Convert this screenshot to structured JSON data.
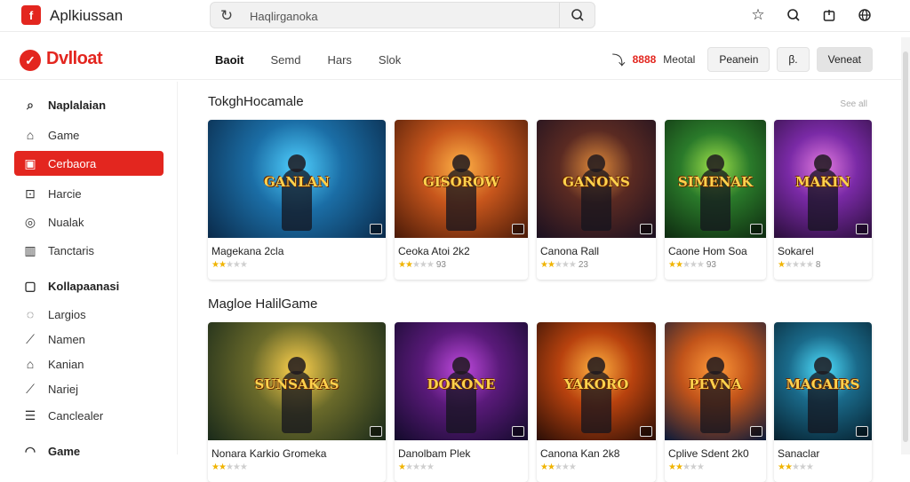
{
  "app": {
    "title": "Aplkiussan",
    "logo_glyph": "f"
  },
  "search": {
    "placeholder": "Haqlirganoka"
  },
  "top_icons": [
    "star-icon",
    "search-icon",
    "bag-icon",
    "globe-icon"
  ],
  "brand": {
    "name": "Dvlloat",
    "color": "#e3261f"
  },
  "tabs": [
    {
      "label": "Baoit",
      "active": true
    },
    {
      "label": "Semd"
    },
    {
      "label": "Hars"
    },
    {
      "label": "Slok"
    }
  ],
  "nav_right": {
    "badge": "8888",
    "label": "Meotal",
    "btn1": "Peanein",
    "btn2": "Veneat",
    "pill_icon": "β."
  },
  "sidebar": {
    "items": [
      {
        "label": "Naplalaian",
        "icon": "⌕",
        "head": true
      },
      {
        "label": "Game",
        "icon": "⌂"
      },
      {
        "label": "Cerbaora",
        "icon": "▣",
        "active": true
      },
      {
        "label": "Harcie",
        "icon": "⊡"
      },
      {
        "label": "Nualak",
        "icon": "◎"
      },
      {
        "label": "Tanctaris",
        "icon": "▥"
      },
      {
        "label": "Kollapaanasi",
        "icon": "▢",
        "head": true
      },
      {
        "label": "Largios",
        "icon": "◌"
      },
      {
        "label": "Namen",
        "icon": "⟋"
      },
      {
        "label": "Kanian",
        "icon": "⌂"
      },
      {
        "label": "Nariej",
        "icon": "⟋"
      },
      {
        "label": "Canclealer",
        "icon": "☰"
      },
      {
        "label": "Game",
        "icon": "◠",
        "head": true
      }
    ]
  },
  "sections": [
    {
      "title": "TokghHocamale",
      "see_all": "See all",
      "cards": [
        {
          "name": "Magekana 2cla",
          "art_title": "GANLAN",
          "rating": 2,
          "count": "",
          "colors": [
            "#0a2a4a",
            "#1b6ea6",
            "#4fd0ff"
          ]
        },
        {
          "name": "Ceoka Atoi 2k2",
          "art_title": "GISOROW",
          "rating": 2,
          "count": "93",
          "colors": [
            "#4a1a08",
            "#c7561c",
            "#ffb347"
          ]
        },
        {
          "name": "Canona Rall",
          "art_title": "GANONS",
          "rating": 2,
          "count": "23",
          "colors": [
            "#1a1020",
            "#5a2a22",
            "#e08a3a"
          ]
        },
        {
          "name": "Caone Hom Soa",
          "art_title": "SIMENAK",
          "rating": 2,
          "count": "93",
          "colors": [
            "#0e2a10",
            "#2a7a2a",
            "#9fe24a"
          ]
        },
        {
          "name": "Sokarel",
          "art_title": "MAKIN",
          "rating": 1,
          "count": "8",
          "colors": [
            "#2a0e3a",
            "#7a2aa6",
            "#e27adf"
          ]
        }
      ]
    },
    {
      "title": "Magloe HalilGame",
      "cards": [
        {
          "name": "Nonara Karkio Gromeka",
          "art_title": "SUNSAKAS",
          "rating": 2,
          "count": "",
          "colors": [
            "#1a2a1a",
            "#6a6a2a",
            "#ffd24d"
          ]
        },
        {
          "name": "Danolbam Plek",
          "art_title": "DOKONE",
          "rating": 1,
          "count": "",
          "colors": [
            "#120a2a",
            "#5a1a7a",
            "#c04adf"
          ]
        },
        {
          "name": "Canona Kan 2k8",
          "art_title": "YAKORO",
          "rating": 2,
          "count": "",
          "colors": [
            "#2a0e06",
            "#b8420e",
            "#ffb040"
          ]
        },
        {
          "name": "Cplive Sdent 2k0",
          "art_title": "PEVNA",
          "rating": 2,
          "count": "",
          "colors": [
            "#0a1a3a",
            "#c2541a",
            "#ff9a3a"
          ]
        },
        {
          "name": "Sanaclar",
          "art_title": "MAGAIRS",
          "rating": 2,
          "count": "",
          "colors": [
            "#06202e",
            "#1a6a8a",
            "#4fe0ff"
          ]
        }
      ]
    }
  ]
}
